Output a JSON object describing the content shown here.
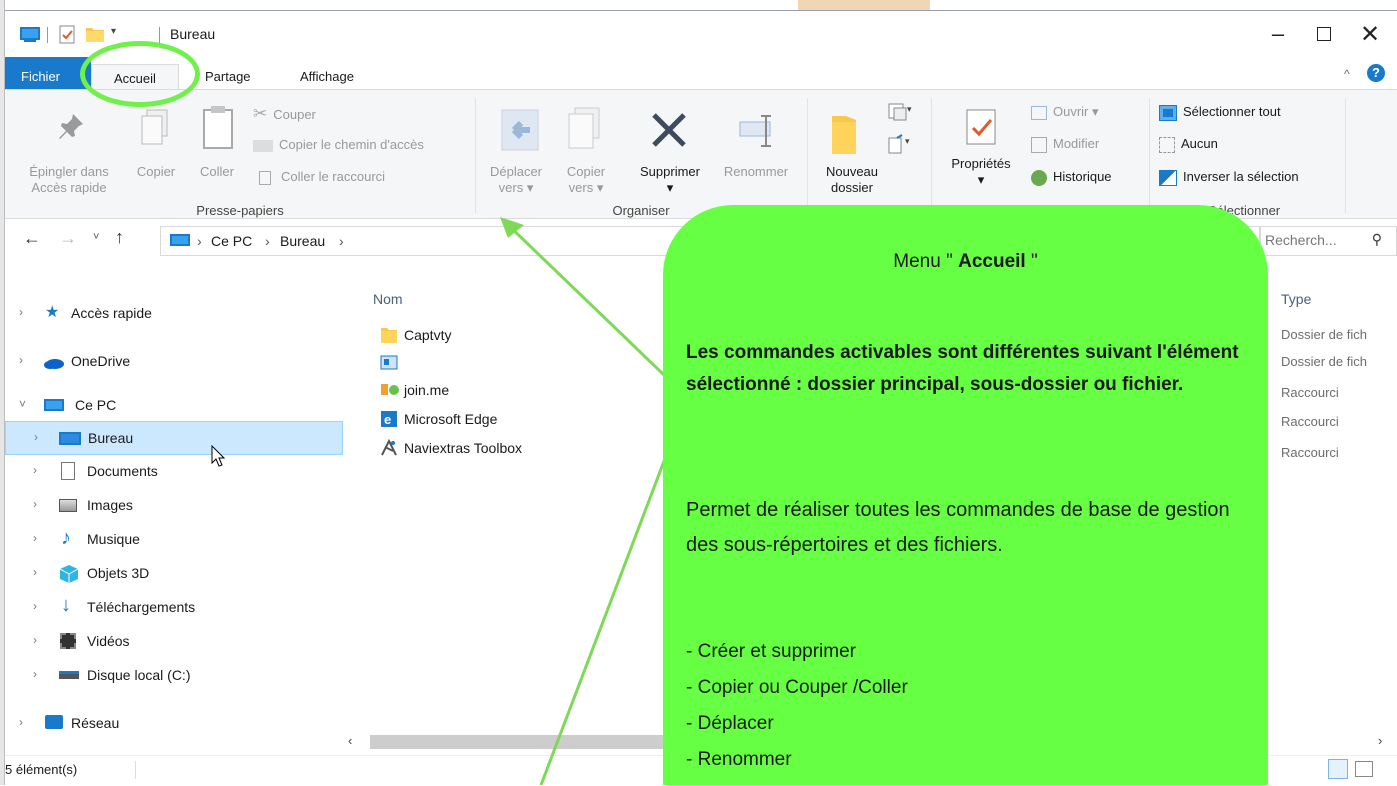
{
  "window": {
    "title": "Bureau"
  },
  "tabs": {
    "file": "Fichier",
    "home": "Accueil",
    "share": "Partage",
    "view": "Affichage"
  },
  "ribbon": {
    "clipboard": {
      "pin_line1": "Épingler dans",
      "pin_line2": "Accès rapide",
      "copy": "Copier",
      "paste": "Coller",
      "cut": "Couper",
      "copy_path": "Copier le chemin d'accès",
      "paste_shortcut": "Coller le raccourci",
      "label": "Presse-papiers"
    },
    "organize": {
      "move_line1": "Déplacer",
      "move_line2": "vers",
      "copyto_line1": "Copier",
      "copyto_line2": "vers",
      "delete": "Supprimer",
      "rename": "Renommer",
      "label": "Organiser"
    },
    "new": {
      "folder_line1": "Nouveau",
      "folder_line2": "dossier"
    },
    "open": {
      "properties": "Propriétés",
      "open": "Ouvrir",
      "edit": "Modifier",
      "history": "Historique"
    },
    "select": {
      "select_all": "Sélectionner tout",
      "none": "Aucun",
      "invert": "Inverser la sélection",
      "label": "Sélectionner"
    }
  },
  "address": {
    "segments": [
      "Ce PC",
      "Bureau"
    ],
    "search_placeholder": "Recherch..."
  },
  "nav_pane": {
    "quick_access": "Accès rapide",
    "onedrive": "OneDrive",
    "this_pc": "Ce PC",
    "items": [
      "Bureau",
      "Documents",
      "Images",
      "Musique",
      "Objets 3D",
      "Téléchargements",
      "Vidéos",
      "Disque local (C:)"
    ],
    "network": "Réseau"
  },
  "file_list": {
    "col_name": "Nom",
    "col_type": "Type",
    "files": [
      {
        "name": "Captvty",
        "type": "Dossier de fich"
      },
      {
        "name": "",
        "type": "Dossier de fich"
      },
      {
        "name": "join.me",
        "type": "Raccourci"
      },
      {
        "name": "Microsoft Edge",
        "type": "Raccourci"
      },
      {
        "name": "Naviextras Toolbox",
        "type": "Raccourci"
      }
    ]
  },
  "status": {
    "count": "5 élément(s)"
  },
  "callout": {
    "title_prefix": "Menu \"",
    "title_bold": "Accueil",
    "title_suffix": "\"",
    "bold_text": "Les commandes activables sont différentes suivant l'élément sélectionné : dossier principal, sous-dossier ou fichier.",
    "paragraph": "Permet de réaliser toutes les commandes de base de gestion des sous-répertoires et des fichiers.",
    "list": [
      "- Créer et  supprimer",
      "- Copier ou Couper /Coller",
      "- Déplacer",
      "- Renommer"
    ]
  },
  "colors": {
    "callout_bg": "#66ff44",
    "accent": "#1979ca",
    "selection": "#cce8ff",
    "annotation": "#6ff04b"
  }
}
